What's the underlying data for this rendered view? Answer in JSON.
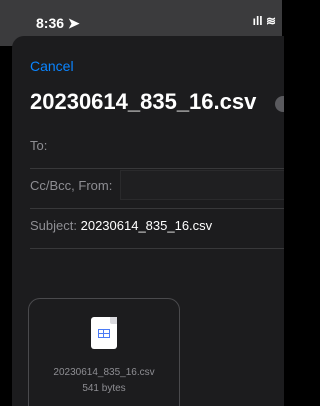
{
  "status": {
    "time": "8:36 ➤",
    "icons": "ıll ≋"
  },
  "compose": {
    "cancel": "Cancel",
    "title": "20230614_835_16.csv",
    "to_label": "To:",
    "cc_label": "Cc/Bcc, From:",
    "subject_label": "Subject:",
    "subject_value": "20230614_835_16.csv"
  },
  "attachment": {
    "name": "20230614_835_16.csv",
    "size": "541 bytes"
  }
}
